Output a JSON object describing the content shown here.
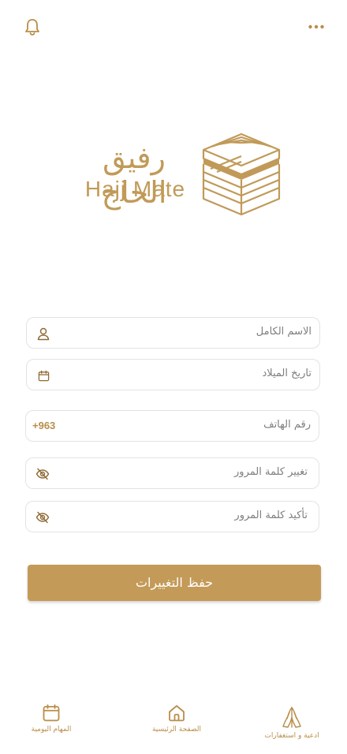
{
  "header": {
    "notification_icon": "bell-icon",
    "menu_icon": "more-horizontal-icon"
  },
  "brand": {
    "name_ar": "رفيق الحاج",
    "name_en": "Hajj Mate",
    "logo_icon": "kaaba-icon"
  },
  "form": {
    "full_name_placeholder": "الاسم الكامل",
    "birth_date_placeholder": "تاريخ الميلاد",
    "phone_placeholder": "رقم الهاتف",
    "phone_code": "+963",
    "new_password_placeholder": "تغيير كلمة المرور",
    "confirm_password_placeholder": "تأكيد كلمة المرور",
    "save_label": "حفظ التغييرات"
  },
  "bottom_nav": {
    "items": [
      {
        "label": "المهام اليومية",
        "icon": "calendar-icon"
      },
      {
        "label": "الصفحة الرئيسية",
        "icon": "home-icon"
      },
      {
        "label": "ادعية و استغفارات",
        "icon": "praying-hands-icon"
      }
    ]
  },
  "colors": {
    "accent": "#c49a58",
    "border": "#e3e3e3",
    "placeholder": "#7e7e7e"
  }
}
